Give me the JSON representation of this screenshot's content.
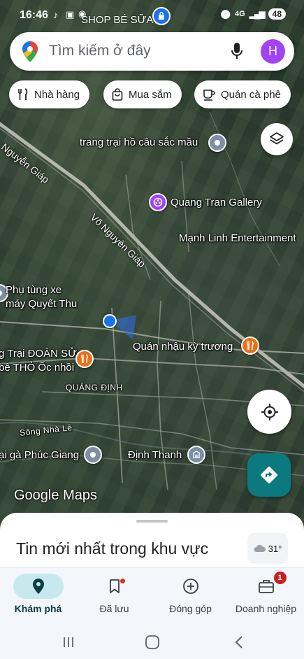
{
  "status_bar": {
    "time": "16:46",
    "overlay_text": "SHOP BÉ SỮA",
    "network": "4G",
    "battery": "48"
  },
  "search": {
    "placeholder": "Tìm kiếm ở đây",
    "avatar_letter": "H"
  },
  "chips": [
    {
      "label": "Nhà hàng",
      "icon": "restaurant-icon"
    },
    {
      "label": "Mua sắm",
      "icon": "shopping-bag-icon"
    },
    {
      "label": "Quán cà phê",
      "icon": "coffee-icon"
    }
  ],
  "map": {
    "roads": [
      {
        "label": "Nguyễn Giáp"
      },
      {
        "label": "Võ Nguyên Giáp"
      }
    ],
    "places": [
      {
        "label": "trang trại hồ câu sắc mầu",
        "pin": "gray"
      },
      {
        "label": "Quang Tran Gallery",
        "pin": "purple"
      },
      {
        "label": "Mạnh Linh Entertainment"
      },
      {
        "label": "Phụ tùng xe máy Quyết Thu",
        "line1": "Phụ tùng xe",
        "line2": "máy Quyết Thu"
      },
      {
        "label": "Quán nhậu kỳ trương",
        "pin": "orange"
      },
      {
        "label": "Trại ĐOÀN SỬ bê THỎ Ốc nhồi",
        "line1": "g Trại ĐOÀN SỬ",
        "line2": "bê THỎ Ốc nhồi",
        "pin": "orange"
      },
      {
        "label": "QUẢNG ĐỊNH"
      },
      {
        "label": "Sông Nhà Lê"
      },
      {
        "label": "ại gà Phúc Giang",
        "pin": "gray"
      },
      {
        "label": "Định Thanh",
        "pin": "slate"
      }
    ],
    "logo_google": "Google",
    "logo_maps": "Maps"
  },
  "sheet": {
    "title": "Tin mới nhất trong khu vực",
    "weather_temp": "31°"
  },
  "bottom_nav": [
    {
      "label": "Khám phá",
      "icon": "explore-pin-icon",
      "active": true
    },
    {
      "label": "Đã lưu",
      "icon": "bookmark-icon",
      "active": false
    },
    {
      "label": "Đóng góp",
      "icon": "add-circle-icon",
      "active": false
    },
    {
      "label": "Doanh nghiệp",
      "icon": "business-icon",
      "active": false,
      "badge": "1"
    }
  ],
  "colors": {
    "accent": "#0b7a7e",
    "active_nav_bg": "#c7e9ee",
    "avatar": "#a142f4",
    "restaurant_pin": "#e8711c"
  }
}
